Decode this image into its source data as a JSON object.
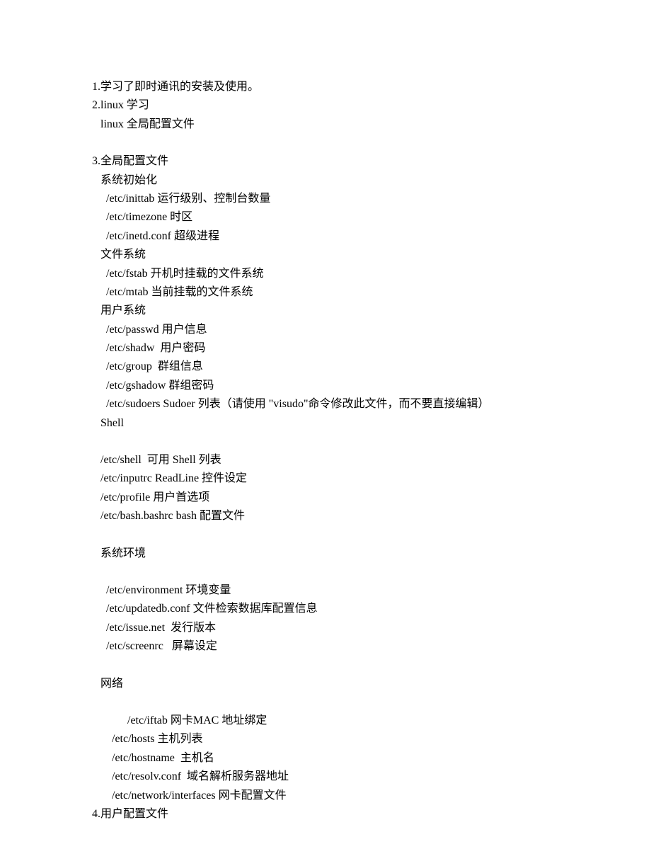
{
  "lines": [
    {
      "cls": "",
      "text": "1.学习了即时通讯的安装及使用。"
    },
    {
      "cls": "",
      "text": "2.linux 学习"
    },
    {
      "cls": "indent1",
      "text": "linux 全局配置文件"
    },
    {
      "cls": "spacer",
      "text": ""
    },
    {
      "cls": "",
      "text": "3.全局配置文件"
    },
    {
      "cls": "indent1",
      "text": "系统初始化"
    },
    {
      "cls": "indent2",
      "text": "/etc/inittab 运行级别、控制台数量"
    },
    {
      "cls": "indent2",
      "text": "/etc/timezone 时区"
    },
    {
      "cls": "indent2",
      "text": "/etc/inetd.conf 超级进程"
    },
    {
      "cls": "indent1",
      "text": "文件系统"
    },
    {
      "cls": "indent2",
      "text": "/etc/fstab 开机时挂载的文件系统"
    },
    {
      "cls": "indent2",
      "text": "/etc/mtab 当前挂载的文件系统"
    },
    {
      "cls": "indent1",
      "text": "用户系统"
    },
    {
      "cls": "indent2",
      "text": "/etc/passwd 用户信息"
    },
    {
      "cls": "indent2",
      "text": "/etc/shadw  用户密码"
    },
    {
      "cls": "indent2",
      "text": "/etc/group  群组信息"
    },
    {
      "cls": "indent2",
      "text": "/etc/gshadow 群组密码"
    },
    {
      "cls": "indent2",
      "text": "/etc/sudoers Sudoer 列表（请使用 \"visudo\"命令修改此文件，而不要直接编辑）"
    },
    {
      "cls": "indent1",
      "text": "Shell"
    },
    {
      "cls": "spacer",
      "text": ""
    },
    {
      "cls": "indent1",
      "text": "/etc/shell  可用 Shell 列表"
    },
    {
      "cls": "indent1",
      "text": "/etc/inputrc ReadLine 控件设定"
    },
    {
      "cls": "indent1",
      "text": "/etc/profile 用户首选项"
    },
    {
      "cls": "indent1",
      "text": "/etc/bash.bashrc bash 配置文件"
    },
    {
      "cls": "spacer",
      "text": ""
    },
    {
      "cls": "indent1",
      "text": "系统环境"
    },
    {
      "cls": "spacer",
      "text": ""
    },
    {
      "cls": "indent2",
      "text": "/etc/environment 环境变量"
    },
    {
      "cls": "indent2",
      "text": "/etc/updatedb.conf 文件检索数据库配置信息"
    },
    {
      "cls": "indent2",
      "text": "/etc/issue.net  发行版本"
    },
    {
      "cls": "indent2",
      "text": "/etc/screenrc   屏幕设定"
    },
    {
      "cls": "spacer",
      "text": ""
    },
    {
      "cls": "indent1",
      "text": "网络"
    },
    {
      "cls": "spacer",
      "text": ""
    },
    {
      "cls": "indent4",
      "text": "/etc/iftab 网卡MAC 地址绑定"
    },
    {
      "cls": "indent3",
      "text": "/etc/hosts 主机列表"
    },
    {
      "cls": "indent3",
      "text": "/etc/hostname  主机名"
    },
    {
      "cls": "indent3",
      "text": "/etc/resolv.conf  域名解析服务器地址"
    },
    {
      "cls": "indent3",
      "text": "/etc/network/interfaces 网卡配置文件"
    },
    {
      "cls": "",
      "text": "4.用户配置文件"
    }
  ]
}
